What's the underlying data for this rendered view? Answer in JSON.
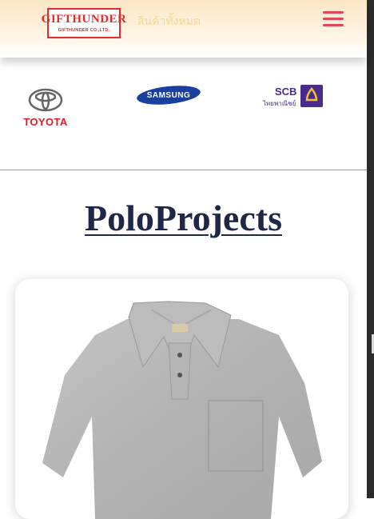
{
  "header": {
    "logo_main": "GIFTHUNDER",
    "logo_sub": "GIFTHUNDER CO.,LTD.",
    "nav_link": "สินค้าทั้งหมด",
    "menu_icon": "hamburger-icon"
  },
  "clients": {
    "toyota": "TOYOTA",
    "samsung": "SAMSUNG",
    "scb": "SCB",
    "scb_sub": "ไทยพาณิชย์"
  },
  "section": {
    "title": "PoloProjects"
  },
  "colors": {
    "brand_red": "#e32b2b",
    "menu_pink": "#e0475b",
    "title_navy": "#1f2747",
    "samsung_blue": "#1b3f9c",
    "scb_purple": "#4a2a8a"
  }
}
